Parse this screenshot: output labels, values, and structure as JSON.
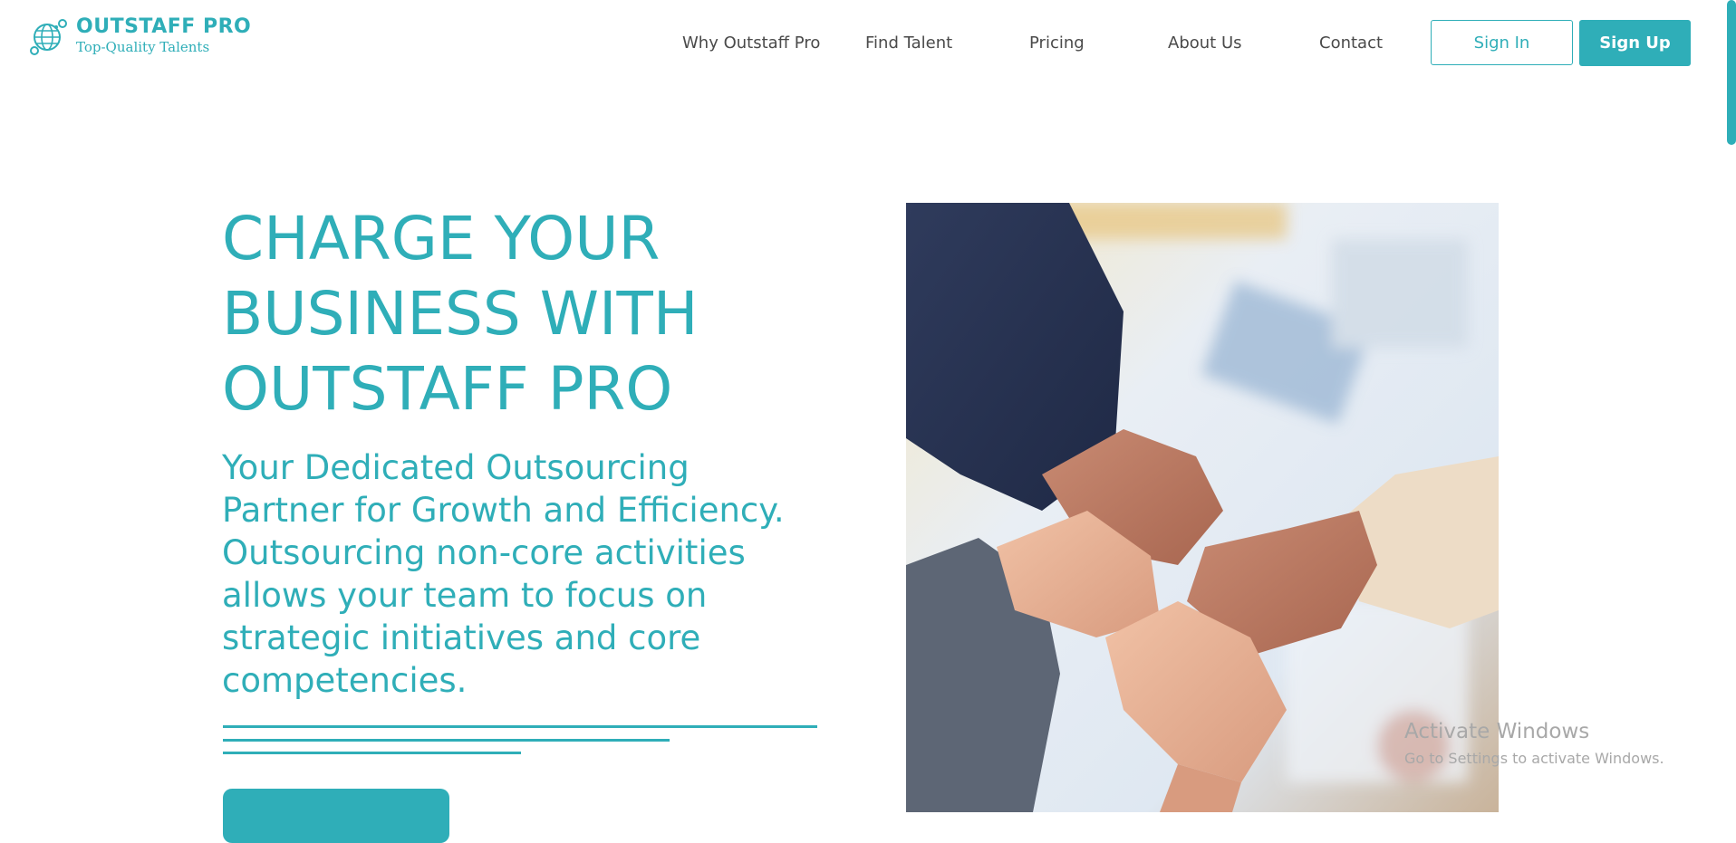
{
  "brand": {
    "name": "OUTSTAFF PRO",
    "tagline": "Top-Quality Talents",
    "color": "#2faeb8"
  },
  "nav": {
    "links": [
      "Why Outstaff Pro",
      "Find Talent",
      "Pricing",
      "About Us",
      "Contact"
    ],
    "sign_in": "Sign In",
    "sign_up": "Sign Up"
  },
  "hero": {
    "title_lines": [
      "CHARGE YOUR",
      "BUSINESS WITH",
      "OUTSTAFF PRO"
    ],
    "subtitle_lines": [
      "Your Dedicated Outsourcing",
      "Partner for Growth and Efficiency.",
      "Outsourcing non-core activities",
      "allows your team to focus on",
      "strategic initiatives and core",
      "competencies."
    ],
    "cta_label": ""
  },
  "watermark": {
    "title": "Activate Windows",
    "subtitle": "Go to Settings to activate Windows."
  }
}
